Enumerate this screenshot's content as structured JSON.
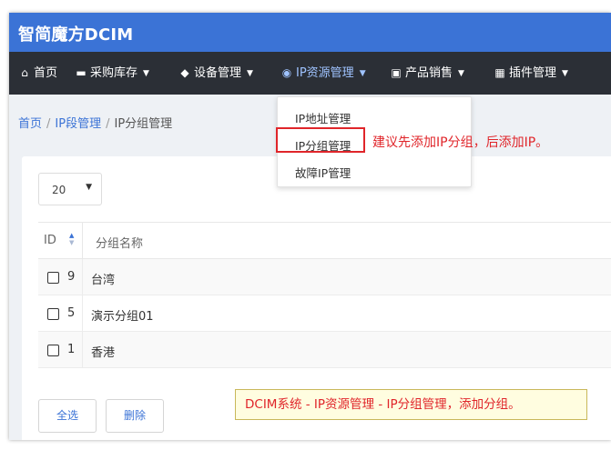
{
  "app": {
    "title": "智简魔方DCIM"
  },
  "nav": {
    "items": [
      {
        "label": "首页",
        "icon": "home-icon",
        "has_dropdown": false
      },
      {
        "label": "采购库存",
        "icon": "hdd-icon",
        "has_dropdown": true
      },
      {
        "label": "设备管理",
        "icon": "cube-icon",
        "has_dropdown": true
      },
      {
        "label": "IP资源管理",
        "icon": "map-marker-icon",
        "has_dropdown": true,
        "active": true
      },
      {
        "label": "产品销售",
        "icon": "cart-icon",
        "has_dropdown": true
      },
      {
        "label": "插件管理",
        "icon": "grid-icon",
        "has_dropdown": true
      }
    ],
    "dropdown": [
      "IP地址管理",
      "IP分组管理",
      "故障IP管理"
    ]
  },
  "breadcrumb": {
    "home": "首页",
    "section": "IP段管理",
    "current": "IP分组管理",
    "separator": "/"
  },
  "page_size": {
    "value": "20"
  },
  "table": {
    "columns": {
      "id": "ID",
      "name": "分组名称"
    },
    "rows": [
      {
        "id": "9",
        "name": "台湾"
      },
      {
        "id": "5",
        "name": "演示分组01"
      },
      {
        "id": "1",
        "name": "香港"
      }
    ]
  },
  "buttons": {
    "select_all": "全选",
    "delete": "删除"
  },
  "annotations": {
    "tip": "建议先添加IP分组，后添加IP。",
    "note": "DCIM系统 - IP资源管理 - IP分组管理，添加分组。"
  },
  "colors": {
    "brand": "#3b73d6",
    "navbar": "#2b2f36",
    "annotation": "#e0252a",
    "note_bg": "#fffde0"
  }
}
